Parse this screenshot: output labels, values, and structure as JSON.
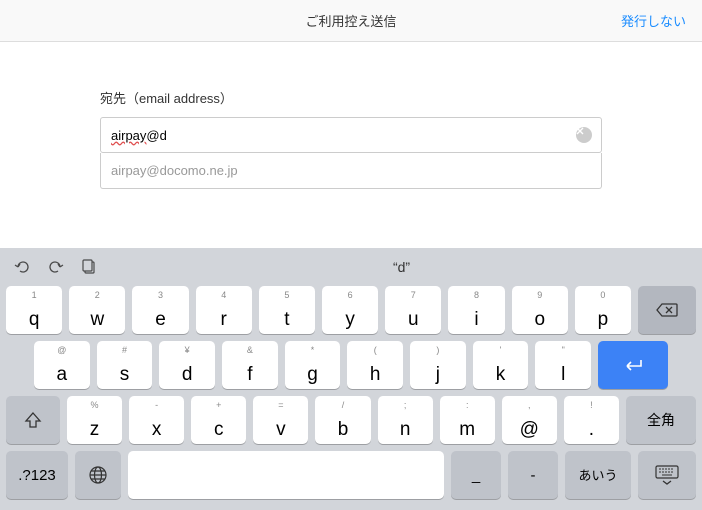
{
  "header": {
    "title": "ご利用控え送信",
    "action": "発行しない"
  },
  "form": {
    "label": "宛先（email address）",
    "input_pre": "airpay",
    "input_post": "@d",
    "suggestion": "airpay@docomo.ne.jp"
  },
  "toolbar": {
    "suggest": "“d”"
  },
  "rows": {
    "r1": [
      {
        "s": "1",
        "m": "q"
      },
      {
        "s": "2",
        "m": "w"
      },
      {
        "s": "3",
        "m": "e"
      },
      {
        "s": "4",
        "m": "r"
      },
      {
        "s": "5",
        "m": "t"
      },
      {
        "s": "6",
        "m": "y"
      },
      {
        "s": "7",
        "m": "u"
      },
      {
        "s": "8",
        "m": "i"
      },
      {
        "s": "9",
        "m": "o"
      },
      {
        "s": "0",
        "m": "p"
      }
    ],
    "r2": [
      {
        "s": "@",
        "m": "a"
      },
      {
        "s": "#",
        "m": "s"
      },
      {
        "s": "¥",
        "m": "d"
      },
      {
        "s": "&",
        "m": "f"
      },
      {
        "s": "*",
        "m": "g"
      },
      {
        "s": "(",
        "m": "h"
      },
      {
        "s": ")",
        "m": "j"
      },
      {
        "s": "'",
        "m": "k"
      },
      {
        "s": "\"",
        "m": "l"
      }
    ],
    "r3": [
      {
        "s": "%",
        "m": "z"
      },
      {
        "s": "-",
        "m": "x"
      },
      {
        "s": "+",
        "m": "c"
      },
      {
        "s": "=",
        "m": "v"
      },
      {
        "s": "/",
        "m": "b"
      },
      {
        "s": ";",
        "m": "n"
      },
      {
        "s": ":",
        "m": "m"
      },
      {
        "s": ",",
        "m": "@"
      },
      {
        "s": "!",
        "m": "."
      }
    ],
    "zen": "全角",
    "num": ".?123",
    "sym1": "_",
    "sym2": "-",
    "aiu": "あいう"
  }
}
